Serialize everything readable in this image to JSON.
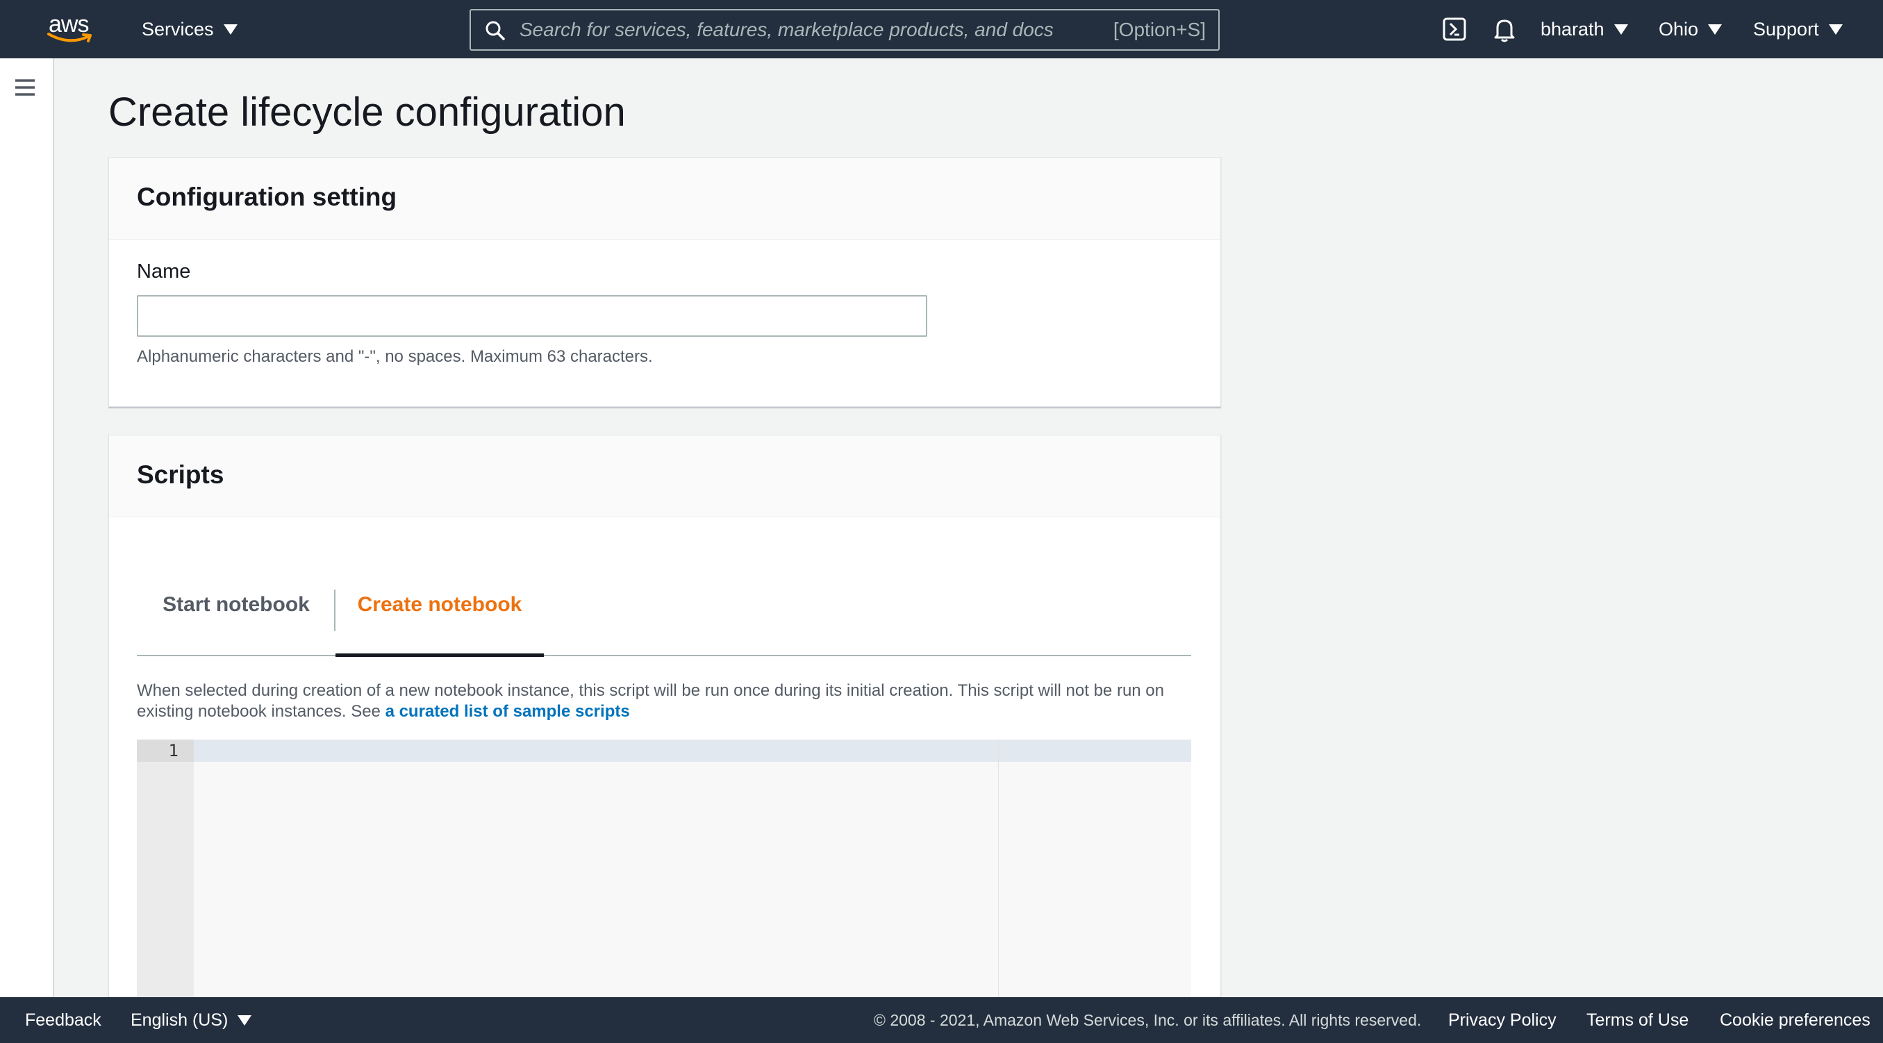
{
  "nav": {
    "logo": "aws",
    "services": "Services",
    "search_placeholder": "Search for services, features, marketplace products, and docs",
    "search_shortcut": "[Option+S]",
    "user": "bharath",
    "region": "Ohio",
    "support": "Support",
    "icons": [
      "cloudshell-icon",
      "bell-icon",
      "search-icon",
      "menu-icon"
    ]
  },
  "page": {
    "title": "Create lifecycle configuration"
  },
  "config_panel": {
    "heading": "Configuration setting",
    "name_label": "Name",
    "name_value": "",
    "name_hint": "Alphanumeric characters and \"-\", no spaces. Maximum 63 characters."
  },
  "scripts_panel": {
    "heading": "Scripts",
    "tabs": [
      {
        "label": "Start notebook",
        "active": false
      },
      {
        "label": "Create notebook",
        "active": true
      }
    ],
    "description": "When selected during creation of a new notebook instance, this script will be run once during its initial creation. This script will not be run on existing notebook instances.  See ",
    "link_text": "a curated list of sample scripts",
    "editor": {
      "line_numbers": [
        "1"
      ],
      "content": ""
    }
  },
  "footer": {
    "feedback": "Feedback",
    "language": "English (US)",
    "copyright": "© 2008 - 2021, Amazon Web Services, Inc. or its affiliates. All rights reserved.",
    "privacy": "Privacy Policy",
    "terms": "Terms of Use",
    "cookies": "Cookie preferences"
  },
  "colors": {
    "nav_bg": "#232f3e",
    "active_tab": "#ec7211",
    "link": "#0073bb",
    "logo_smile": "#ff9900"
  }
}
